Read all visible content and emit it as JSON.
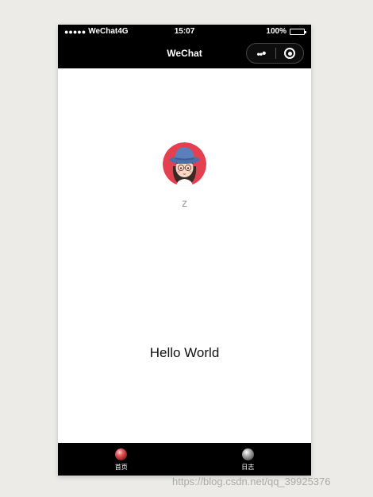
{
  "status_bar": {
    "signal_dots": "●●●●●",
    "carrier": "WeChat4G",
    "time": "15:07",
    "battery": "100%"
  },
  "nav_bar": {
    "title": "WeChat",
    "more_icon": "more-dots-icon",
    "close_icon": "target-circle-icon"
  },
  "profile": {
    "nickname": "z",
    "avatar_icon": "girl-avatar-icon"
  },
  "content": {
    "greeting": "Hello World"
  },
  "tab_bar": {
    "items": [
      {
        "label": "首页",
        "icon": "red-ball-icon",
        "active": true
      },
      {
        "label": "日志",
        "icon": "gray-ball-icon",
        "active": false
      }
    ]
  },
  "watermark": "https://blog.csdn.net/qq_39925376",
  "colors": {
    "page_background": "#ecebe7",
    "bar_background": "#000000",
    "nickname_text": "#9b9b9b",
    "avatar_ring": "#e5404f"
  }
}
